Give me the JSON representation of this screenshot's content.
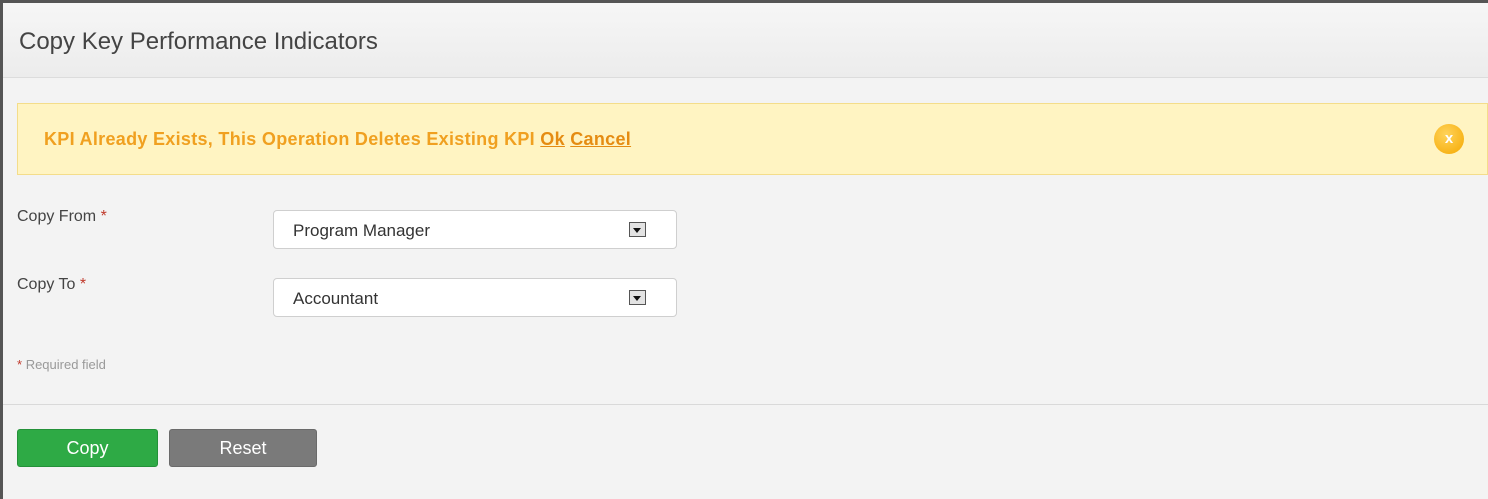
{
  "panel": {
    "title": "Copy Key Performance Indicators"
  },
  "alert": {
    "message": "KPI Already Exists, This Operation Deletes Existing KPI",
    "ok_label": "Ok",
    "cancel_label": "Cancel",
    "close_label": "x",
    "color_text": "#f0a020",
    "color_background": "#fff4c2"
  },
  "form": {
    "copy_from": {
      "label": "Copy From",
      "required_mark": "*",
      "value": "Program Manager"
    },
    "copy_to": {
      "label": "Copy To",
      "required_mark": "*",
      "value": "Accountant"
    },
    "required_note_mark": "*",
    "required_note": "Required field"
  },
  "buttons": {
    "copy_label": "Copy",
    "reset_label": "Reset",
    "copy_color": "#2eaa45",
    "reset_color": "#7a7a7a"
  },
  "icons": {
    "alert_close": "close-icon",
    "select_arrow": "chevron-down-icon"
  }
}
